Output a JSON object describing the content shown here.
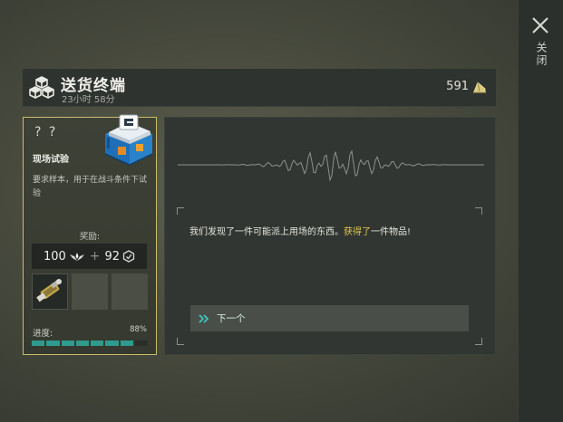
{
  "header": {
    "title": "送货终端",
    "timer": "23小时 58分",
    "currency_value": "591",
    "icon": "cubes-icon",
    "currency_icon": "alloy-icon"
  },
  "close": {
    "label": "关闭",
    "icon": "close-icon"
  },
  "card": {
    "unknown_mark": "? ?",
    "name": "现场试验",
    "description": "要求样本，用于在战斗条件下试验",
    "reward_label": "奖励:",
    "reward_main": "100",
    "reward_secondary": "92",
    "reward_plus": "+",
    "progress_label": "进度:",
    "progress_percent": "88%",
    "progress_fraction": 0.88,
    "crate_icon": "supply-crate-icon",
    "item_icon": "weapon-part-icon"
  },
  "dialog": {
    "text_before": "我们发现了一件可能派上用场的东西。",
    "text_highlight": "获得了",
    "text_after": "一件物品!",
    "next_label": "下一个"
  },
  "colors": {
    "accent_gold": "#cdbb6c",
    "highlight_text": "#e0c84a",
    "progress": "#2f9a8e",
    "next_arrow": "#3ec4c0"
  }
}
